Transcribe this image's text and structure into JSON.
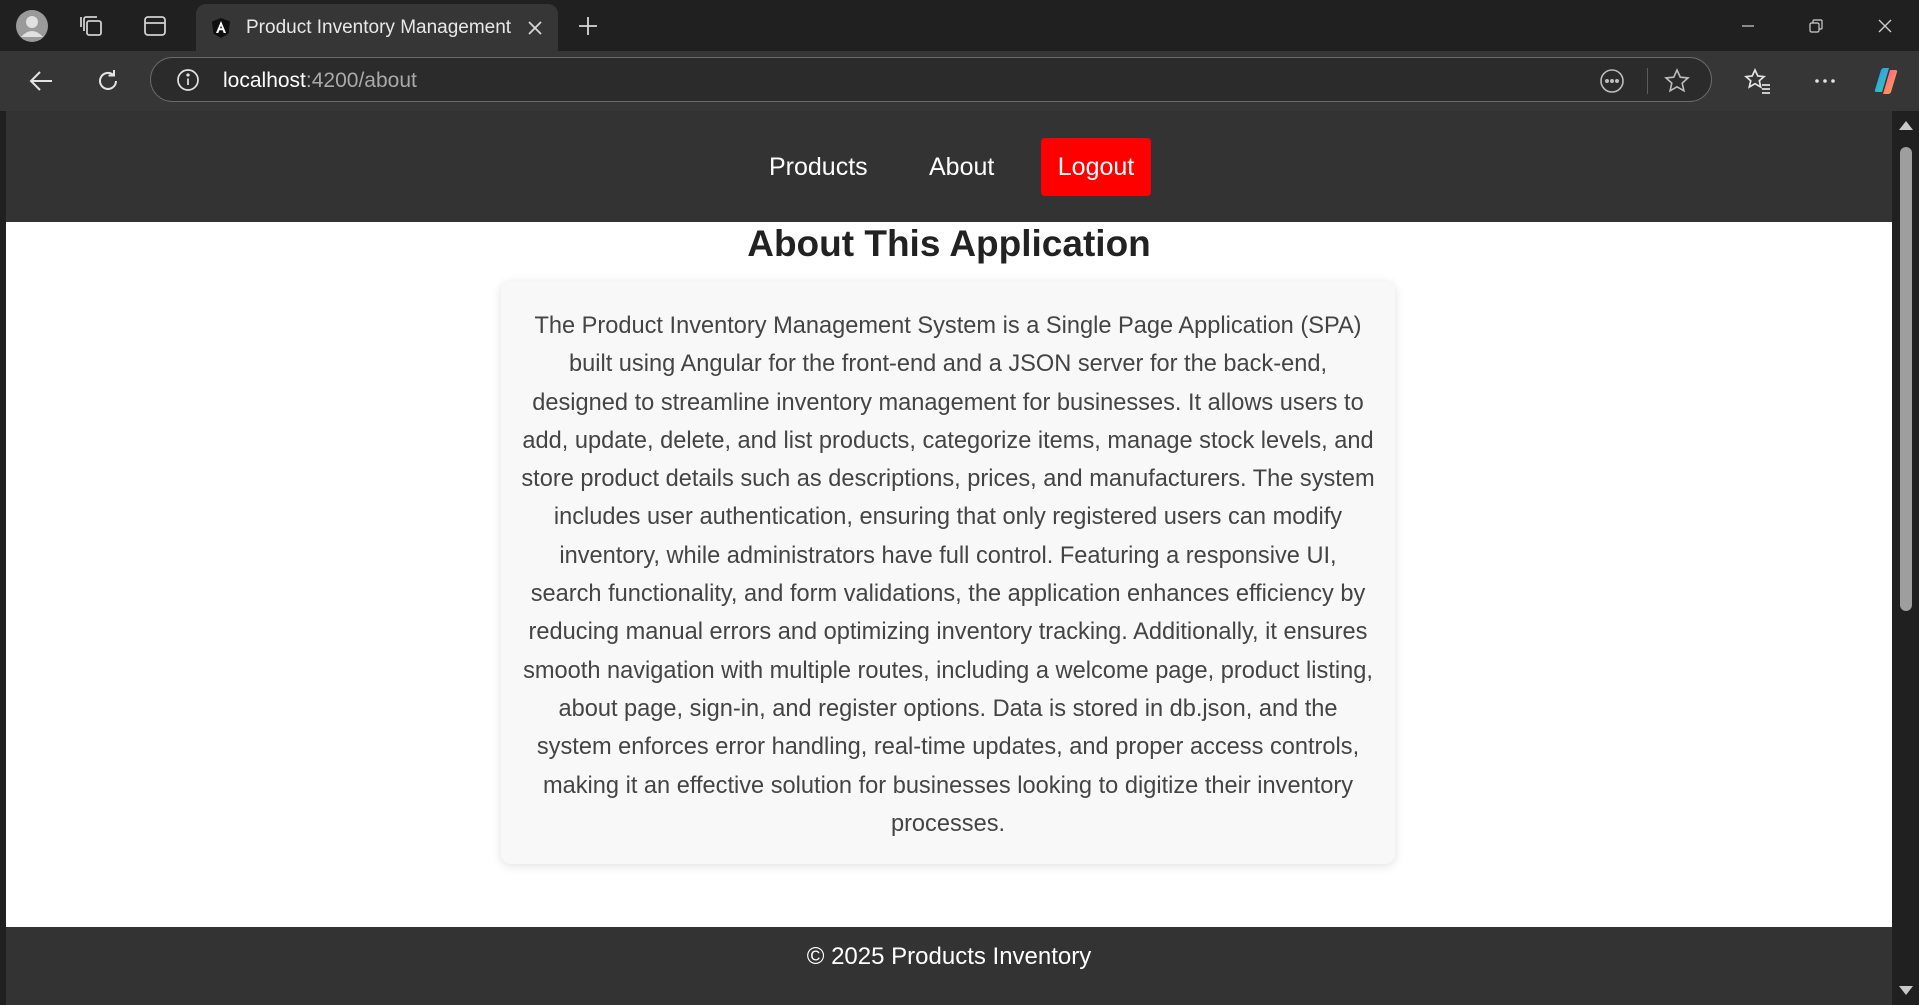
{
  "browser": {
    "tab": {
      "title": "Product Inventory Management",
      "favicon": "angular-icon"
    },
    "address": {
      "host": "localhost",
      "path": ":4200/about"
    },
    "icons": [
      "profile-icon",
      "workspaces-icon",
      "tab-actions-icon",
      "new-tab-icon",
      "minimize-icon",
      "restore-icon",
      "close-window-icon",
      "back-icon",
      "refresh-icon",
      "site-info-icon",
      "reader-icon",
      "favorite-star-icon",
      "favorites-icon",
      "more-icon",
      "copilot-icon"
    ]
  },
  "navbar": {
    "links": [
      {
        "label": "Products"
      },
      {
        "label": "About"
      }
    ],
    "logout_label": "Logout",
    "logout_color": "#ff0000",
    "bg_color": "#333333"
  },
  "page": {
    "title": "About This Application",
    "body": "The Product Inventory Management System is a Single Page Application (SPA) built using Angular for the front-end and a JSON server for the back-end, designed to streamline inventory management for businesses. It allows users to add, update, delete, and list products, categorize items, manage stock levels, and store product details such as descriptions, prices, and manufacturers. The system includes user authentication, ensuring that only registered users can modify inventory, while administrators have full control. Featuring a responsive UI, search functionality, and form validations, the application enhances efficiency by reducing manual errors and optimizing inventory tracking. Additionally, it ensures smooth navigation with multiple routes, including a welcome page, product listing, about page, sign-in, and register options. Data is stored in db.json, and the system enforces error handling, real-time updates, and proper access controls, making it an effective solution for businesses looking to digitize their inventory processes."
  },
  "footer": {
    "text": "© 2025 Products Inventory"
  }
}
